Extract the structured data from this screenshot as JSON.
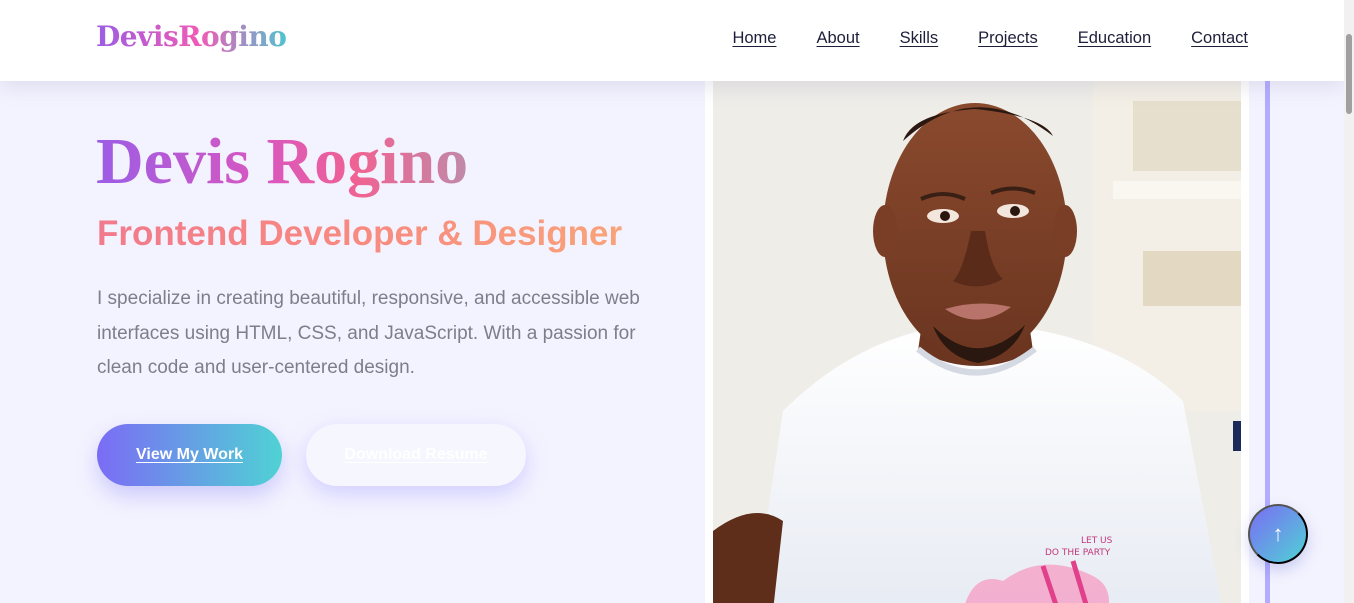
{
  "logo": "DevisRogino",
  "nav": [
    "Home",
    "About",
    "Skills",
    "Projects",
    "Education",
    "Contact"
  ],
  "hero": {
    "name": "Devis Rogino",
    "role": "Frontend Developer & Designer",
    "description": "I specialize in creating beautiful, responsive, and accessible web interfaces using HTML, CSS, and JavaScript. With a passion for clean code and user-centered design.",
    "primary_button": "View My Work",
    "secondary_button": "Download Resume"
  },
  "scroll_top_icon": "↑",
  "colors": {
    "accent_purple": "#7b6cf5",
    "accent_teal": "#4fd2d4",
    "accent_pink": "#f15bb5",
    "accent_coral": "#f88a80",
    "page_bg": "#f3f3ff"
  }
}
